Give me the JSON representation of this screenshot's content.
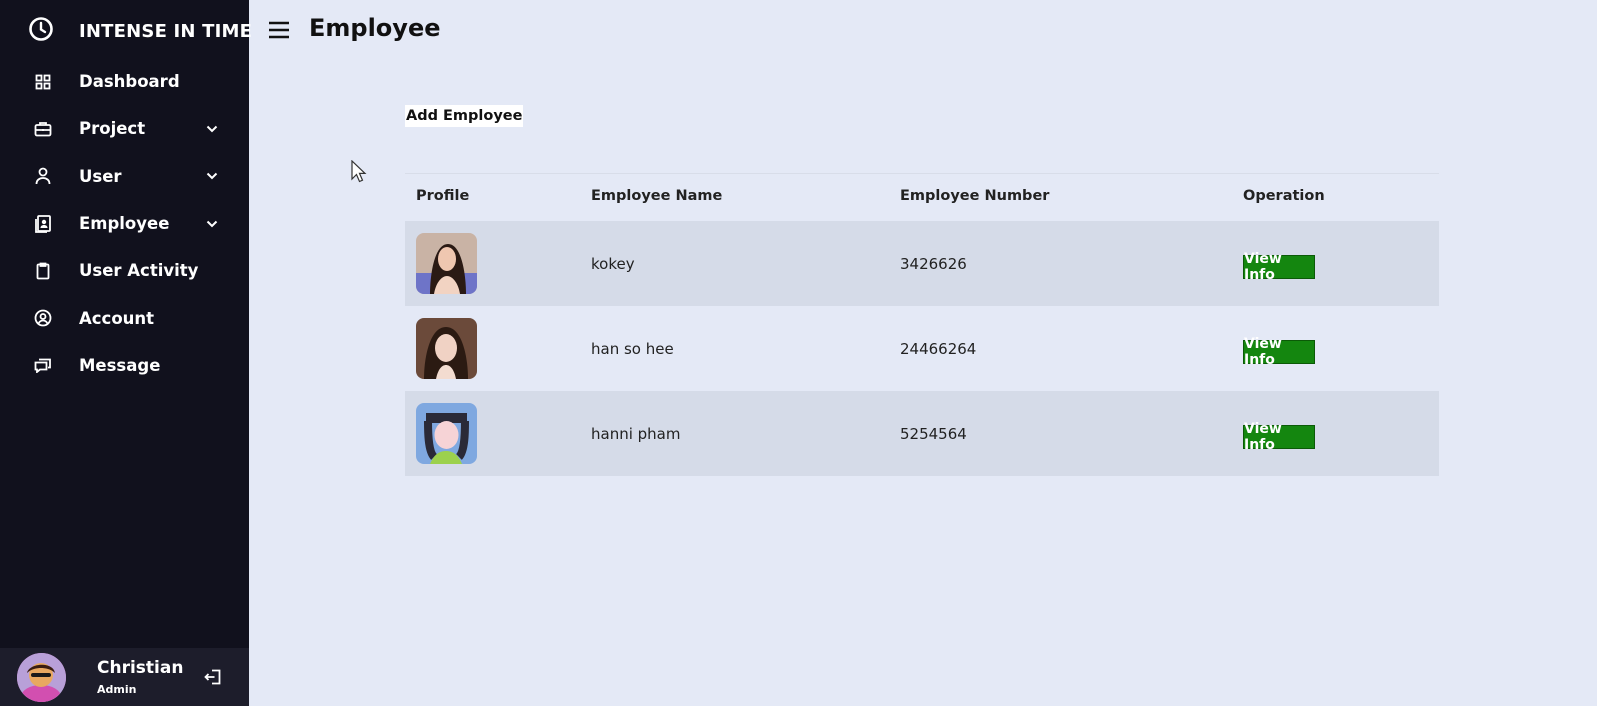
{
  "brand": {
    "name": "INTENSE IN TIME",
    "icon": "clock-icon"
  },
  "sidebar": {
    "items": [
      {
        "label": "Dashboard",
        "icon": "grid-icon",
        "has_chevron": false
      },
      {
        "label": "Project",
        "icon": "briefcase-icon",
        "has_chevron": true
      },
      {
        "label": "User",
        "icon": "person-icon",
        "has_chevron": true
      },
      {
        "label": "Employee",
        "icon": "contact-icon",
        "has_chevron": true
      },
      {
        "label": "User Activity",
        "icon": "clipboard-icon",
        "has_chevron": false
      },
      {
        "label": "Account",
        "icon": "account-circle-icon",
        "has_chevron": false
      },
      {
        "label": "Message",
        "icon": "chat-icon",
        "has_chevron": false
      }
    ]
  },
  "user": {
    "name": "Christian",
    "role": "Admin"
  },
  "header": {
    "title": "Employee"
  },
  "main": {
    "add_button_label": "Add Employee",
    "table": {
      "headers": [
        "Profile",
        "Employee Name",
        "Employee Number",
        "Operation"
      ],
      "rows": [
        {
          "name": "kokey",
          "number": "3426626",
          "action": "View Info"
        },
        {
          "name": "han so hee",
          "number": "24466264",
          "action": "View Info"
        },
        {
          "name": "hanni pham",
          "number": "5254564",
          "action": "View Info"
        }
      ]
    }
  },
  "colors": {
    "sidebar_bg": "#11111d",
    "page_bg": "#e4e9f6",
    "button_green": "#14860f",
    "row_stripe": "#d5dbe8"
  }
}
